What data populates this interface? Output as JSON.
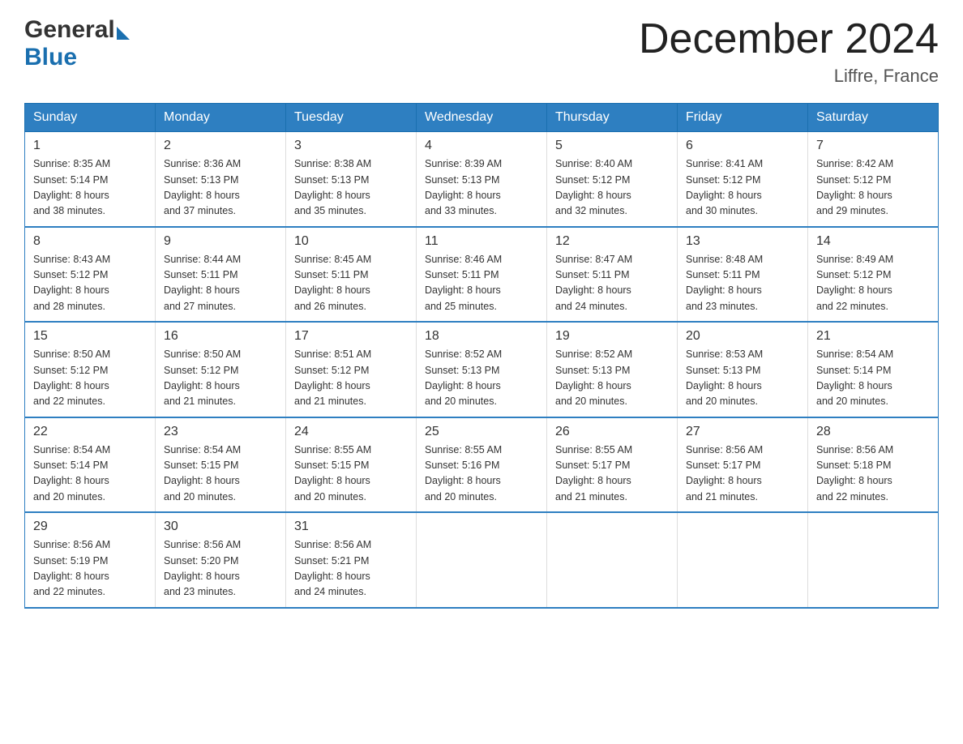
{
  "logo": {
    "general": "General",
    "blue": "Blue",
    "triangle": "▶"
  },
  "title": "December 2024",
  "location": "Liffre, France",
  "weekdays": [
    "Sunday",
    "Monday",
    "Tuesday",
    "Wednesday",
    "Thursday",
    "Friday",
    "Saturday"
  ],
  "weeks": [
    [
      {
        "day": "1",
        "sunrise": "8:35 AM",
        "sunset": "5:14 PM",
        "daylight": "8 hours and 38 minutes."
      },
      {
        "day": "2",
        "sunrise": "8:36 AM",
        "sunset": "5:13 PM",
        "daylight": "8 hours and 37 minutes."
      },
      {
        "day": "3",
        "sunrise": "8:38 AM",
        "sunset": "5:13 PM",
        "daylight": "8 hours and 35 minutes."
      },
      {
        "day": "4",
        "sunrise": "8:39 AM",
        "sunset": "5:13 PM",
        "daylight": "8 hours and 33 minutes."
      },
      {
        "day": "5",
        "sunrise": "8:40 AM",
        "sunset": "5:12 PM",
        "daylight": "8 hours and 32 minutes."
      },
      {
        "day": "6",
        "sunrise": "8:41 AM",
        "sunset": "5:12 PM",
        "daylight": "8 hours and 30 minutes."
      },
      {
        "day": "7",
        "sunrise": "8:42 AM",
        "sunset": "5:12 PM",
        "daylight": "8 hours and 29 minutes."
      }
    ],
    [
      {
        "day": "8",
        "sunrise": "8:43 AM",
        "sunset": "5:12 PM",
        "daylight": "8 hours and 28 minutes."
      },
      {
        "day": "9",
        "sunrise": "8:44 AM",
        "sunset": "5:11 PM",
        "daylight": "8 hours and 27 minutes."
      },
      {
        "day": "10",
        "sunrise": "8:45 AM",
        "sunset": "5:11 PM",
        "daylight": "8 hours and 26 minutes."
      },
      {
        "day": "11",
        "sunrise": "8:46 AM",
        "sunset": "5:11 PM",
        "daylight": "8 hours and 25 minutes."
      },
      {
        "day": "12",
        "sunrise": "8:47 AM",
        "sunset": "5:11 PM",
        "daylight": "8 hours and 24 minutes."
      },
      {
        "day": "13",
        "sunrise": "8:48 AM",
        "sunset": "5:11 PM",
        "daylight": "8 hours and 23 minutes."
      },
      {
        "day": "14",
        "sunrise": "8:49 AM",
        "sunset": "5:12 PM",
        "daylight": "8 hours and 22 minutes."
      }
    ],
    [
      {
        "day": "15",
        "sunrise": "8:50 AM",
        "sunset": "5:12 PM",
        "daylight": "8 hours and 22 minutes."
      },
      {
        "day": "16",
        "sunrise": "8:50 AM",
        "sunset": "5:12 PM",
        "daylight": "8 hours and 21 minutes."
      },
      {
        "day": "17",
        "sunrise": "8:51 AM",
        "sunset": "5:12 PM",
        "daylight": "8 hours and 21 minutes."
      },
      {
        "day": "18",
        "sunrise": "8:52 AM",
        "sunset": "5:13 PM",
        "daylight": "8 hours and 20 minutes."
      },
      {
        "day": "19",
        "sunrise": "8:52 AM",
        "sunset": "5:13 PM",
        "daylight": "8 hours and 20 minutes."
      },
      {
        "day": "20",
        "sunrise": "8:53 AM",
        "sunset": "5:13 PM",
        "daylight": "8 hours and 20 minutes."
      },
      {
        "day": "21",
        "sunrise": "8:54 AM",
        "sunset": "5:14 PM",
        "daylight": "8 hours and 20 minutes."
      }
    ],
    [
      {
        "day": "22",
        "sunrise": "8:54 AM",
        "sunset": "5:14 PM",
        "daylight": "8 hours and 20 minutes."
      },
      {
        "day": "23",
        "sunrise": "8:54 AM",
        "sunset": "5:15 PM",
        "daylight": "8 hours and 20 minutes."
      },
      {
        "day": "24",
        "sunrise": "8:55 AM",
        "sunset": "5:15 PM",
        "daylight": "8 hours and 20 minutes."
      },
      {
        "day": "25",
        "sunrise": "8:55 AM",
        "sunset": "5:16 PM",
        "daylight": "8 hours and 20 minutes."
      },
      {
        "day": "26",
        "sunrise": "8:55 AM",
        "sunset": "5:17 PM",
        "daylight": "8 hours and 21 minutes."
      },
      {
        "day": "27",
        "sunrise": "8:56 AM",
        "sunset": "5:17 PM",
        "daylight": "8 hours and 21 minutes."
      },
      {
        "day": "28",
        "sunrise": "8:56 AM",
        "sunset": "5:18 PM",
        "daylight": "8 hours and 22 minutes."
      }
    ],
    [
      {
        "day": "29",
        "sunrise": "8:56 AM",
        "sunset": "5:19 PM",
        "daylight": "8 hours and 22 minutes."
      },
      {
        "day": "30",
        "sunrise": "8:56 AM",
        "sunset": "5:20 PM",
        "daylight": "8 hours and 23 minutes."
      },
      {
        "day": "31",
        "sunrise": "8:56 AM",
        "sunset": "5:21 PM",
        "daylight": "8 hours and 24 minutes."
      },
      null,
      null,
      null,
      null
    ]
  ],
  "labels": {
    "sunrise": "Sunrise:",
    "sunset": "Sunset:",
    "daylight": "Daylight:"
  }
}
